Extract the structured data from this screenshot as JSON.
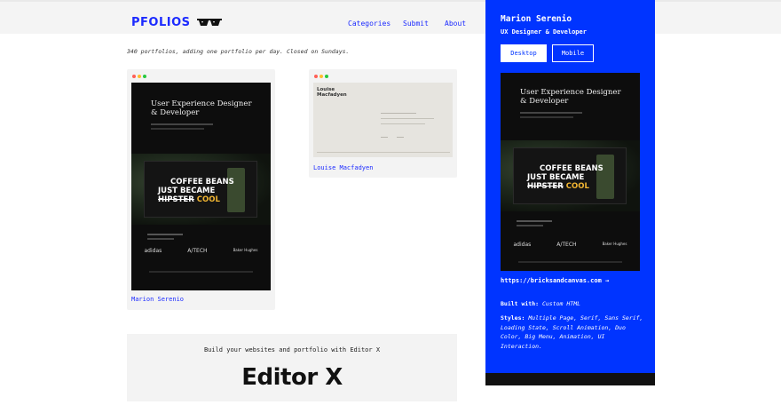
{
  "header": {
    "logo": "PFOLIOS",
    "nav": [
      "Categories",
      "Submit",
      "About"
    ]
  },
  "tagline": "340 portfolios, adding one portfolio per day. Closed on Sundays.",
  "cards": [
    {
      "label": "Marion Serenio",
      "preview": {
        "headline_line1": "User Experience Designer",
        "headline_line2": "& Developer",
        "coffee_line1": "COFFEE BEANS",
        "coffee_line2": "JUST BECAME",
        "coffee_line3a": "HIPSTER",
        "coffee_line3b": "COOL",
        "logos": [
          "adidas",
          "A/TECH",
          "Baker Hughes"
        ]
      }
    },
    {
      "label": "Louise Macfadyen",
      "preview": {
        "name_line1": "Louise",
        "name_line2": "Macfadyen"
      }
    }
  ],
  "promo": {
    "text": "Build your websites and portfolio with Editor X",
    "logo": "Editor X"
  },
  "panel": {
    "name": "Marion Serenio",
    "role": "UX Designer & Developer",
    "btn_desktop": "Desktop",
    "btn_mobile": "Mobile",
    "link": "https://bricksandcanvas.com →",
    "built_label": "Built with:",
    "built_value": "Custom HTML",
    "styles_label": "Styles:",
    "styles_value": "Multiple Page, Serif, Sans Serif, Loading State, Scroll Animation, Duo Color, Big Menu, Animation, UI Interaction.",
    "preview": {
      "headline_line1": "User Experience Designer",
      "headline_line2": "& Developer",
      "coffee_line1": "COFFEE BEANS",
      "coffee_line2": "JUST BECAME",
      "coffee_line3a": "HIPSTER",
      "coffee_line3b": "COOL",
      "logos": [
        "adidas",
        "A/TECH",
        "Baker Hughes"
      ]
    }
  },
  "colors": {
    "accent": "#1c2bff",
    "panel": "#0034ff",
    "coffee_yellow": "#f2b632"
  }
}
